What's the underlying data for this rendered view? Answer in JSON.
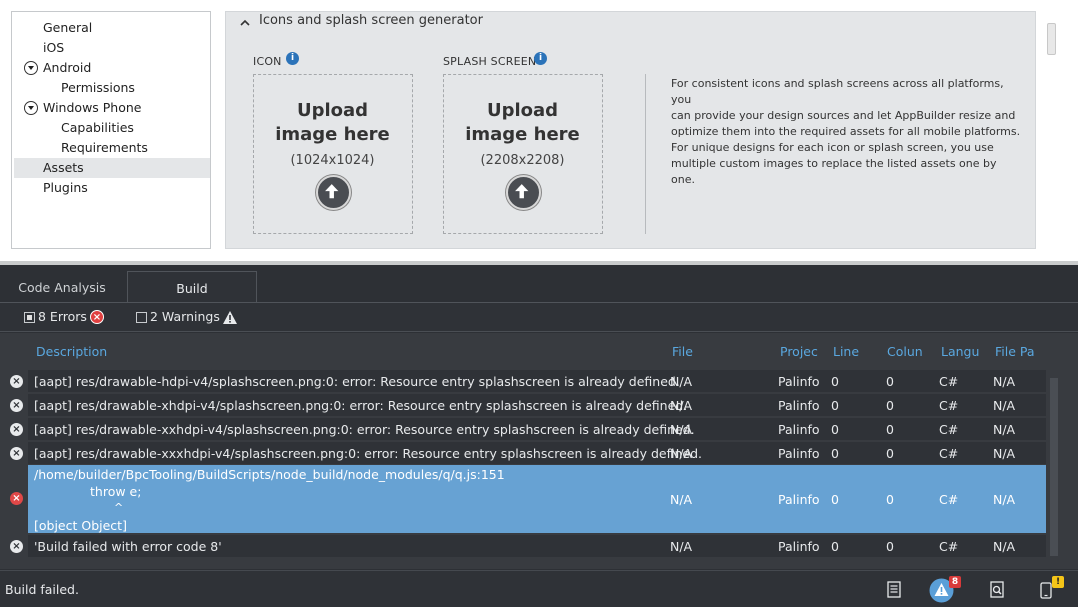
{
  "nav": {
    "items": [
      {
        "label": "General"
      },
      {
        "label": "iOS"
      },
      {
        "label": "Android"
      },
      {
        "label": "Permissions"
      },
      {
        "label": "Windows Phone"
      },
      {
        "label": "Capabilities"
      },
      {
        "label": "Requirements"
      },
      {
        "label": "Assets"
      },
      {
        "label": "Plugins"
      }
    ],
    "selected": "Assets"
  },
  "section": {
    "title": "Icons and splash screen generator",
    "icon_label": "ICON",
    "splash_label": "SPLASH SCREEN",
    "icon_upload": {
      "line1": "Upload",
      "line2": "image here",
      "size": "(1024x1024)"
    },
    "splash_upload": {
      "line1": "Upload",
      "line2": "image here",
      "size": "(2208x2208)"
    },
    "desc1_l1": "For consistent icons and splash screens across all platforms, you",
    "desc1_l2": "can provide your design sources and let AppBuilder resize and",
    "desc1_l3": "optimize them into the required assets for all mobile platforms.",
    "desc2_l1": "For unique designs for each icon or splash screen, you use",
    "desc2_l2": "multiple custom images to replace the listed assets one by one."
  },
  "tabs": [
    {
      "label": "Code Analysis",
      "active": false
    },
    {
      "label": "Build",
      "active": true
    }
  ],
  "filters": {
    "errors_label": "8 Errors",
    "errors_checked": true,
    "warnings_label": "2 Warnings",
    "warnings_checked": false
  },
  "columns": [
    "Description",
    "File",
    "Projec",
    "Line",
    "Colun",
    "Langu",
    "File Pa"
  ],
  "rows": [
    {
      "desc": "[aapt] res/drawable-hdpi-v4/splashscreen.png:0: error: Resource entry splashscreen is already defined.",
      "file": "N/A",
      "project": "Palinfo",
      "line": "0",
      "column": "0",
      "lang": "C#",
      "path": "N/A"
    },
    {
      "desc": "[aapt] res/drawable-xhdpi-v4/splashscreen.png:0: error: Resource entry splashscreen is already defined.",
      "file": "N/A",
      "project": "Palinfo",
      "line": "0",
      "column": "0",
      "lang": "C#",
      "path": "N/A"
    },
    {
      "desc": "[aapt] res/drawable-xxhdpi-v4/splashscreen.png:0: error: Resource entry splashscreen is already defined.",
      "file": "N/A",
      "project": "Palinfo",
      "line": "0",
      "column": "0",
      "lang": "C#",
      "path": "N/A"
    },
    {
      "desc": "[aapt] res/drawable-xxxhdpi-v4/splashscreen.png:0: error: Resource entry splashscreen is already defined.",
      "file": "N/A",
      "project": "Palinfo",
      "line": "0",
      "column": "0",
      "lang": "C#",
      "path": "N/A"
    },
    {
      "desc_l1": "/home/builder/BpcTooling/BuildScripts/node_build/node_modules/q/q.js:151",
      "desc_l2": "throw e;",
      "desc_l3": "^",
      "desc_l4": "[object Object]",
      "file": "N/A",
      "project": "Palinfo",
      "line": "0",
      "column": "0",
      "lang": "C#",
      "path": "N/A"
    },
    {
      "desc": "'Build failed with error code 8'",
      "file": "N/A",
      "project": "Palinfo",
      "line": "0",
      "column": "0",
      "lang": "C#",
      "path": "N/A"
    }
  ],
  "status": {
    "text": "Build failed.",
    "error_badge": "8",
    "warning_badge": "!"
  },
  "colors": {
    "accent_blue": "#5aa8e0",
    "selected_row": "#67a2d3",
    "error_red": "#e04040",
    "warning_yellow": "#f5c518"
  }
}
